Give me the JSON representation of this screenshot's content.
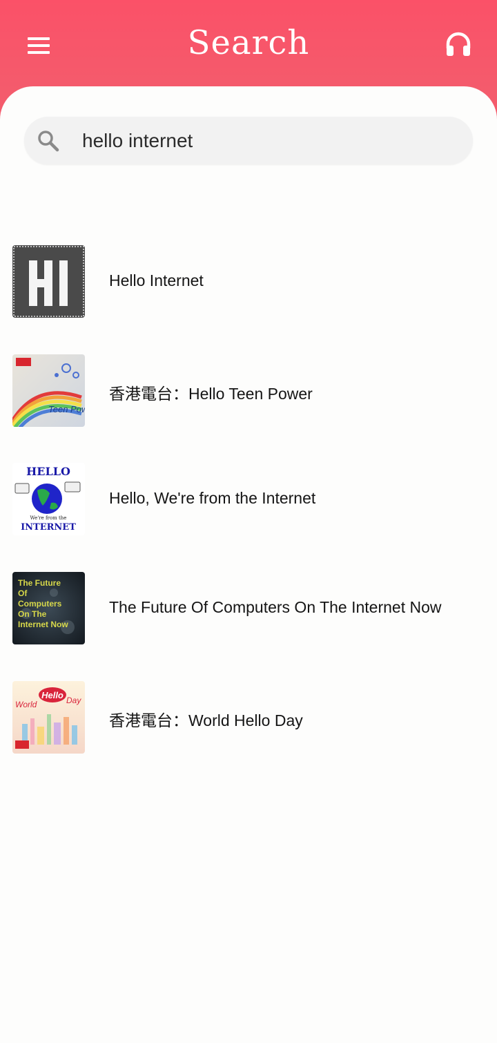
{
  "header": {
    "title": "Search",
    "menu_icon": "hamburger-menu-icon",
    "right_icon": "headphones-icon"
  },
  "search": {
    "icon": "search-icon",
    "value": "hello internet",
    "placeholder": ""
  },
  "results": [
    {
      "title": "Hello Internet",
      "thumb_text": "HI"
    },
    {
      "title": "香港電台：Hello Teen Power",
      "thumb_text": "Teen Power"
    },
    {
      "title": "Hello, We're from the Internet",
      "thumb_text_top": "HELLO",
      "thumb_text_mid": "We're from the",
      "thumb_text_bottom": "INTERNET"
    },
    {
      "title": "The Future Of Computers On The Internet Now",
      "thumb_lines": [
        "The Future",
        "Of",
        "Computers",
        "On The",
        "Internet Now"
      ]
    },
    {
      "title": "香港電台：World Hello Day",
      "thumb_text_hello": "Hello",
      "thumb_text_world": "World",
      "thumb_text_day": "Day"
    }
  ],
  "colors": {
    "header_bg": "#f95368",
    "content_bg": "#fdfdfc",
    "search_bg": "#f2f2f2"
  }
}
